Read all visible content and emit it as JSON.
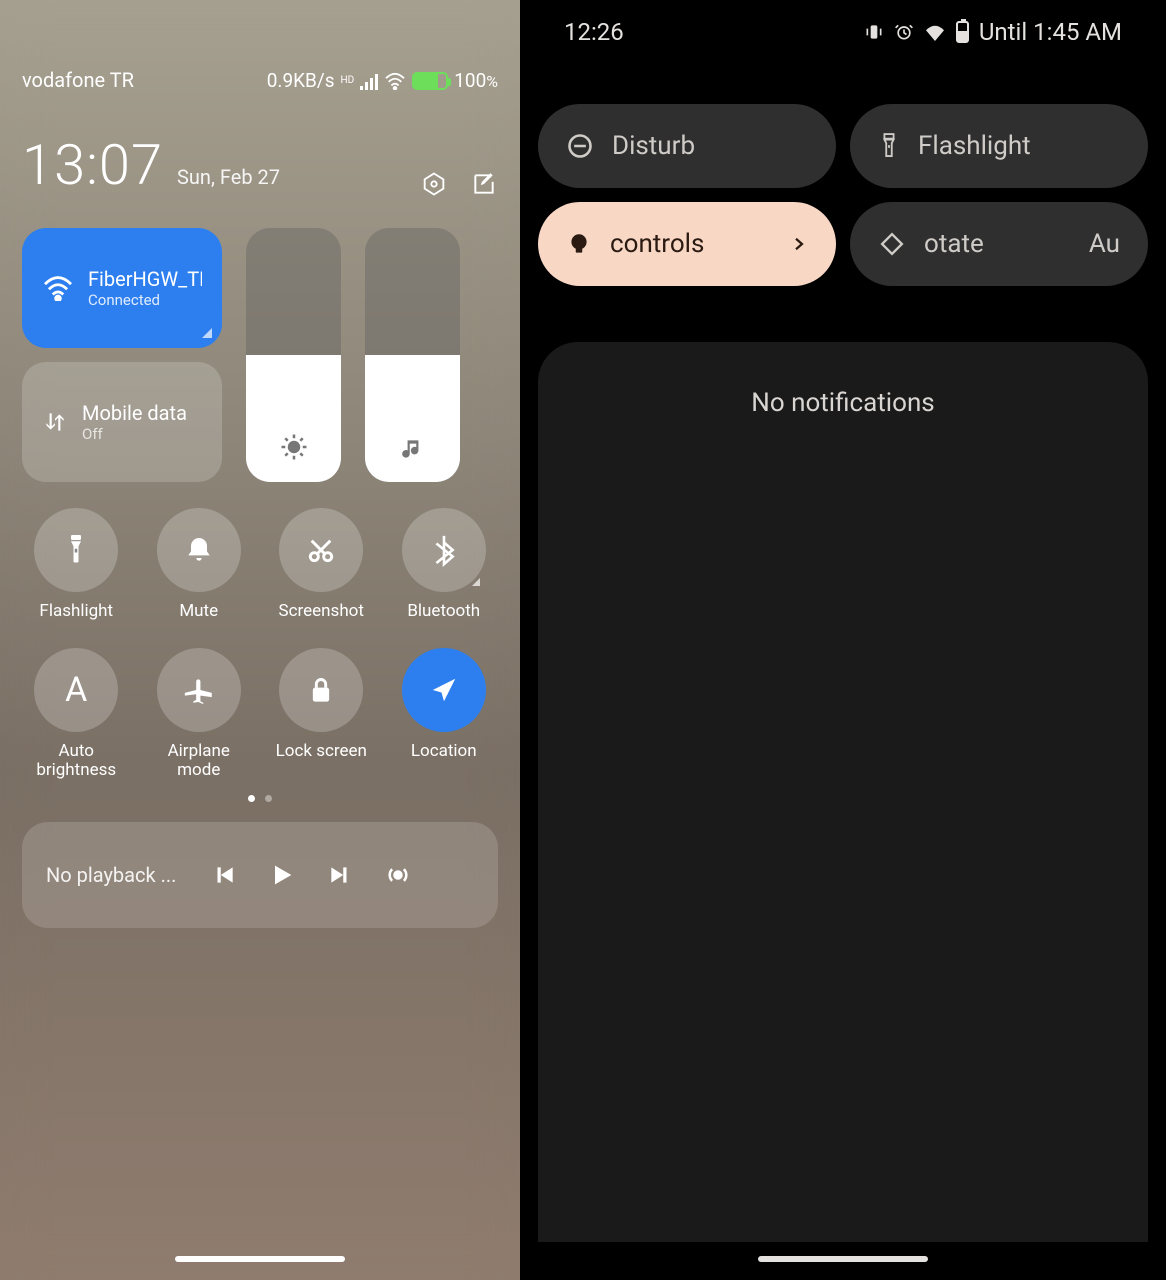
{
  "left": {
    "statusbar": {
      "carrier": "vodafone TR",
      "speed": "0.9KB/s",
      "hd": "HD",
      "battery_pct": "100",
      "battery_pct_suffix": "%"
    },
    "clock": {
      "time": "13:07",
      "date": "Sun, Feb 27"
    },
    "wifi": {
      "name": "FiberHGW_TP",
      "sub": "Connected"
    },
    "mobile_data": {
      "name": "Mobile data",
      "sub": "Off"
    },
    "sliders": {
      "brightness_pct": 50,
      "volume_pct": 50
    },
    "quick": [
      {
        "label": "Flashlight",
        "icon": "flashlight",
        "active": false,
        "expandable": false
      },
      {
        "label": "Mute",
        "icon": "bell",
        "active": false,
        "expandable": false
      },
      {
        "label": "Screenshot",
        "icon": "scissors",
        "active": false,
        "expandable": false
      },
      {
        "label": "Bluetooth",
        "icon": "bluetooth",
        "active": false,
        "expandable": true
      },
      {
        "label": "Auto brightness",
        "icon": "A",
        "active": false,
        "expandable": false
      },
      {
        "label": "Airplane mode",
        "icon": "plane",
        "active": false,
        "expandable": false
      },
      {
        "label": "Lock screen",
        "icon": "lock",
        "active": false,
        "expandable": false
      },
      {
        "label": "Location",
        "icon": "location",
        "active": true,
        "expandable": false
      }
    ],
    "page_dots": {
      "total": 2,
      "active": 0
    },
    "media": {
      "title": "No playback ..."
    }
  },
  "right": {
    "statusbar": {
      "time": "12:26",
      "battery_text": "Until 1:45 AM"
    },
    "tiles": {
      "disturb": "Disturb",
      "flashlight": "Flashlight",
      "controls": "controls",
      "rotate1": "otate",
      "rotate2": "Au"
    },
    "notifications": "No notifications"
  }
}
